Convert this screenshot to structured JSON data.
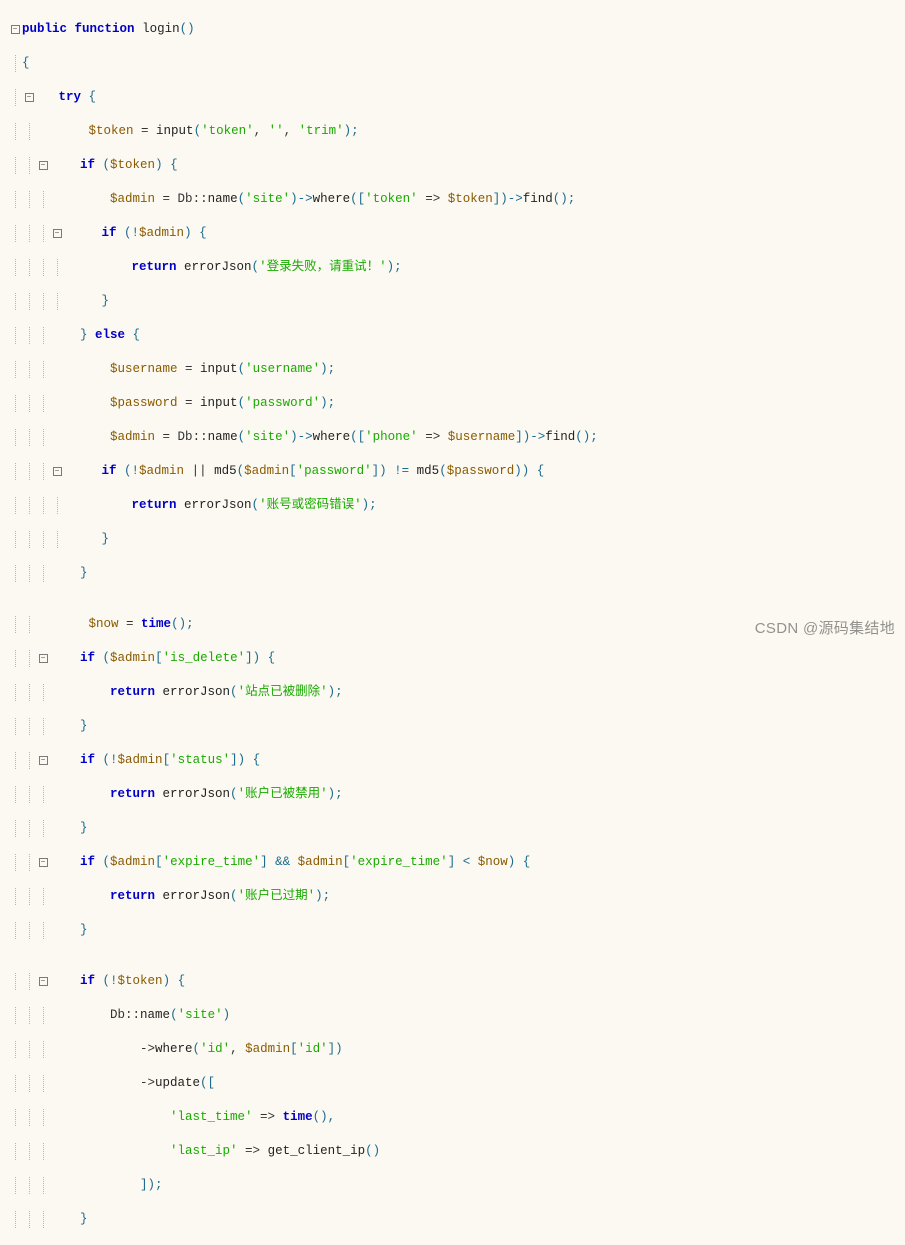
{
  "watermark": "CSDN @源码集结地",
  "code": {
    "l1": {
      "kw1": "public",
      "kw2": "function",
      "name": "login",
      "paren": "()"
    },
    "l2": "{",
    "l3": {
      "kw": "try",
      "brc": " {"
    },
    "l4": {
      "a": "$token ",
      "op": "= ",
      "b": "input",
      "c": "(",
      "d": "'token'",
      "e": ", ",
      "f": "''",
      "g": ", ",
      "h": "'trim'",
      "i": ");"
    },
    "l5": {
      "kw": "if",
      "a": " (",
      "v": "$token",
      "b": ") {"
    },
    "l6": {
      "a": "$admin ",
      "op": "= ",
      "b": "Db",
      "c": "::",
      "d": "name",
      "e": "(",
      "f": "'site'",
      "g": ")->",
      "h": "where",
      "i": "([",
      "j": "'token'",
      "k": " => ",
      "l": "$token",
      "m": "])->",
      "n": "find",
      "o": "();"
    },
    "l7": {
      "kw": "if",
      "a": " (!",
      "v": "$admin",
      "b": ") {"
    },
    "l8": {
      "kw": "return",
      "a": " errorJson",
      "b": "(",
      "c": "'登录失败，请重试！'",
      "d": ");"
    },
    "l9": "}",
    "l10": {
      "a": "} ",
      "kw": "else",
      "b": " {"
    },
    "l11": {
      "a": "$username ",
      "op": "= ",
      "b": "input",
      "c": "(",
      "d": "'username'",
      "e": ");"
    },
    "l12": {
      "a": "$password ",
      "op": "= ",
      "b": "input",
      "c": "(",
      "d": "'password'",
      "e": ");"
    },
    "l13": {
      "a": "$admin ",
      "op": "= ",
      "b": "Db",
      "c": "::",
      "d": "name",
      "e": "(",
      "f": "'site'",
      "g": ")->",
      "h": "where",
      "i": "([",
      "j": "'phone'",
      "k": " => ",
      "l": "$username",
      "m": "])->",
      "n": "find",
      "o": "();"
    },
    "l14": {
      "kw": "if",
      "a": " (!",
      "v1": "$admin",
      "b": " || ",
      "c": "md5",
      "d": "(",
      "v2": "$admin",
      "e": "[",
      "f": "'password'",
      "g": "]) != ",
      "h": "md5",
      "i": "(",
      "v3": "$password",
      "j": ")) {"
    },
    "l15": {
      "kw": "return",
      "a": " errorJson",
      "b": "(",
      "c": "'账号或密码错误'",
      "d": ");"
    },
    "l16": "}",
    "l17": "}",
    "l18": "",
    "l19": {
      "a": "$now ",
      "op": "= ",
      "b": "time",
      "c": "();"
    },
    "l20": {
      "kw": "if",
      "a": " (",
      "v": "$admin",
      "b": "[",
      "c": "'is_delete'",
      "d": "]) {"
    },
    "l21": {
      "kw": "return",
      "a": " errorJson",
      "b": "(",
      "c": "'站点已被删除'",
      "d": ");"
    },
    "l22": "}",
    "l23": {
      "kw": "if",
      "a": " (!",
      "v": "$admin",
      "b": "[",
      "c": "'status'",
      "d": "]) {"
    },
    "l24": {
      "kw": "return",
      "a": " errorJson",
      "b": "(",
      "c": "'账户已被禁用'",
      "d": ");"
    },
    "l25": "}",
    "l26": {
      "kw": "if",
      "a": " (",
      "v1": "$admin",
      "b": "[",
      "c": "'expire_time'",
      "d": "] && ",
      "v2": "$admin",
      "e": "[",
      "f": "'expire_time'",
      "g": "] < ",
      "v3": "$now",
      "h": ") {"
    },
    "l27": {
      "kw": "return",
      "a": " errorJson",
      "b": "(",
      "c": "'账户已过期'",
      "d": ");"
    },
    "l28": "}",
    "l29": "",
    "l30": {
      "kw": "if",
      "a": " (!",
      "v": "$token",
      "b": ") {"
    },
    "l31": {
      "a": "Db",
      "b": "::",
      "c": "name",
      "d": "(",
      "e": "'site'",
      "f": ")"
    },
    "l32": {
      "a": "->",
      "b": "where",
      "c": "(",
      "d": "'id'",
      "e": ", ",
      "f": "$admin",
      "g": "[",
      "h": "'id'",
      "i": "])"
    },
    "l33": {
      "a": "->",
      "b": "update",
      "c": "(["
    },
    "l34": {
      "a": "'last_time'",
      "b": " => ",
      "c": "time",
      "d": "(),"
    },
    "l35": {
      "a": "'last_ip'",
      "b": " => ",
      "c": "get_client_ip",
      "d": "()"
    },
    "l36": "]);",
    "l37": "}"
  }
}
